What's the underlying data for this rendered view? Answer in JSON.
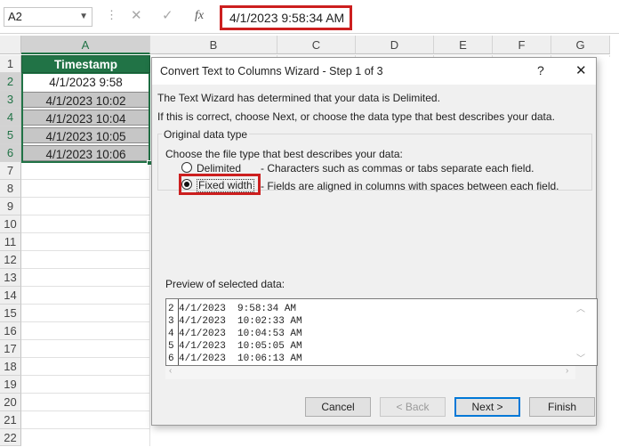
{
  "formula_bar": {
    "name_box": "A2",
    "cancel_icon": "✕",
    "enter_icon": "✓",
    "fx_label": "fx",
    "formula": "4/1/2023  9:58:34 AM"
  },
  "grid": {
    "columns": [
      "A",
      "B",
      "C",
      "D",
      "E",
      "F",
      "G"
    ],
    "rows": [
      "1",
      "2",
      "3",
      "4",
      "5",
      "6",
      "7",
      "8",
      "9",
      "10",
      "11",
      "12",
      "13",
      "14",
      "15",
      "16",
      "17",
      "18",
      "19",
      "20",
      "21",
      "22"
    ],
    "header": "Timestamp",
    "values": [
      "4/1/2023 9:58",
      "4/1/2023 10:02",
      "4/1/2023 10:04",
      "4/1/2023 10:05",
      "4/1/2023 10:06"
    ],
    "header_color": "#217346"
  },
  "dialog": {
    "title": "Convert Text to Columns Wizard - Step 1 of 3",
    "help": "?",
    "close": "✕",
    "line1": "The Text Wizard has determined that your data is Delimited.",
    "line2": "If this is correct, choose Next, or choose the data type that best describes your data.",
    "group_label": "Original data type",
    "choose_label": "Choose the file type that best describes your data:",
    "options": [
      {
        "label": "Delimited",
        "desc": "- Characters such as commas or tabs separate each field.",
        "selected": false
      },
      {
        "label": "Fixed width",
        "desc": "- Fields are aligned in columns with spaces between each field.",
        "selected": true
      }
    ],
    "preview_label": "Preview of selected data:",
    "preview_rows": [
      {
        "num": "2",
        "text": "4/1/2023  9:58:34 AM"
      },
      {
        "num": "3",
        "text": "4/1/2023  10:02:33 AM"
      },
      {
        "num": "4",
        "text": "4/1/2023  10:04:53 AM"
      },
      {
        "num": "5",
        "text": "4/1/2023  10:05:05 AM"
      },
      {
        "num": "6",
        "text": "4/1/2023  10:06:13 AM"
      }
    ],
    "buttons": {
      "cancel": "Cancel",
      "back": "< Back",
      "next": "Next >",
      "finish": "Finish"
    },
    "highlight_color": "#cc1f1f"
  }
}
